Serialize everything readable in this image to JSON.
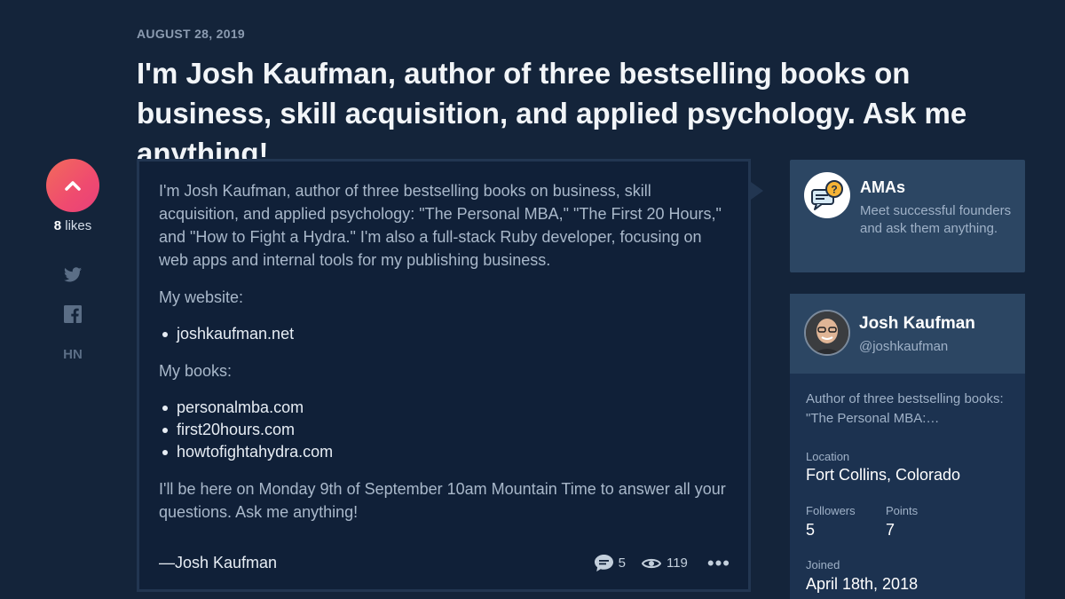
{
  "post": {
    "date": "AUGUST 28, 2019",
    "title": "I'm Josh Kaufman, author of three bestselling books on business, skill acquisition, and applied psychology. Ask me anything!",
    "intro": "I'm Josh Kaufman, author of three bestselling books on business, skill acquisition, and applied psychology: \"The Personal MBA,\" \"The First 20 Hours,\" and \"How to Fight a Hydra.\" I'm also a full-stack Ruby developer, focusing on web apps and internal tools for my publishing business.",
    "website_label": "My website:",
    "website_links": [
      "joshkaufman.net"
    ],
    "books_label": "My books:",
    "book_links": [
      "personalmba.com",
      "first20hours.com",
      "howtofightahydra.com"
    ],
    "closing": "I'll be here on Monday 9th of September 10am Mountain Time to answer all your questions. Ask me anything!",
    "signature": "—Josh Kaufman",
    "comments": "5",
    "views": "119",
    "more": "•••"
  },
  "vote": {
    "count": "8",
    "label": "likes"
  },
  "share": {
    "hn_label": "HN"
  },
  "ama": {
    "title": "AMAs",
    "description": "Meet successful founders and ask them anything."
  },
  "profile": {
    "name": "Josh Kaufman",
    "handle": "@joshkaufman",
    "bio": "Author of three bestselling books: \"The Personal MBA:…",
    "location_label": "Location",
    "location": "Fort Collins, Colorado",
    "followers_label": "Followers",
    "followers": "5",
    "points_label": "Points",
    "points": "7",
    "joined_label": "Joined",
    "joined": "April 18th, 2018"
  },
  "colors": {
    "background": "#14243a",
    "vote_gradient_start": "#f26b5b",
    "vote_gradient_end": "#e8407a",
    "card": "#2c4663"
  }
}
